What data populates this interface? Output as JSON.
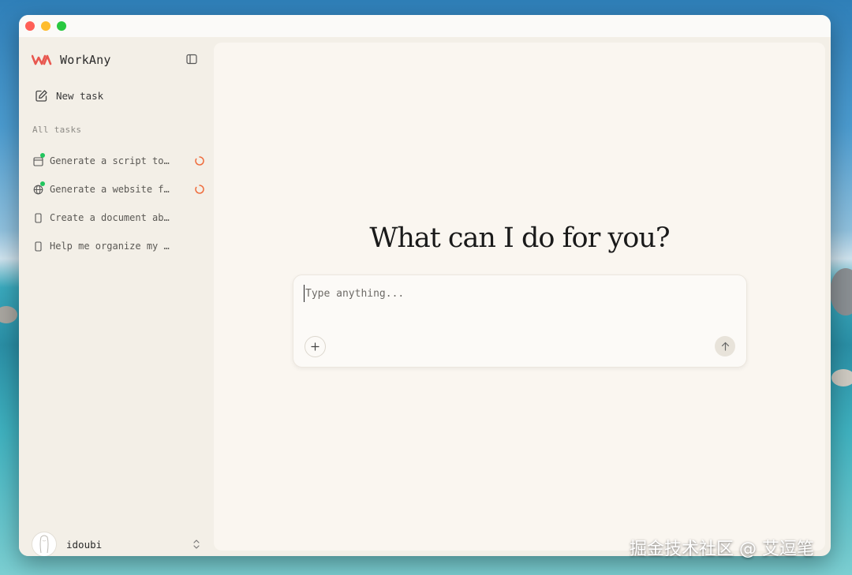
{
  "app": {
    "name": "WorkAny"
  },
  "sidebar": {
    "new_task_label": "New task",
    "section_label": "All tasks",
    "tasks": [
      {
        "label": "Generate a script to…",
        "icon": "calendar-icon",
        "status": "running",
        "has_dot": true
      },
      {
        "label": "Generate a website f…",
        "icon": "globe-icon",
        "status": "running",
        "has_dot": true
      },
      {
        "label": "Create a document ab…",
        "icon": "phone-icon",
        "status": "idle",
        "has_dot": false
      },
      {
        "label": "Help me organize my …",
        "icon": "phone-icon",
        "status": "idle",
        "has_dot": false
      }
    ],
    "user": {
      "name": "idoubi"
    }
  },
  "main": {
    "headline": "What can I do for you?",
    "composer": {
      "placeholder": "Type anything..."
    }
  },
  "watermark": "掘金技术社区 @ 艾逗笔",
  "colors": {
    "accent": "#e8574f",
    "status_dot": "#22c55e",
    "spinner": "#ef6b3b"
  }
}
